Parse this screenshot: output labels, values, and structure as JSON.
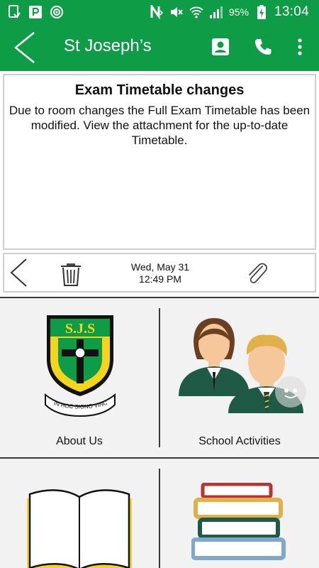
{
  "status_bar": {
    "battery": "95%",
    "time": "13:04"
  },
  "app_bar": {
    "title": "St Joseph’s"
  },
  "message": {
    "title": "Exam Timetable changes",
    "body": "Due to room changes the Full Exam Timetable has been modified. View the attachment for the up-to-date Timetable."
  },
  "toolbar": {
    "date": "Wed, May 31",
    "time": "12:49 PM"
  },
  "tiles": [
    {
      "label": "About Us"
    },
    {
      "label": "School Activities"
    }
  ],
  "crest": {
    "letters": "S.J.S",
    "motto": "IN HOC SIGNO VINCES"
  },
  "colors": {
    "brand_green": "#0e9c47",
    "crest_yellow": "#f2d51c",
    "blazer_green": "#1e5a45"
  }
}
